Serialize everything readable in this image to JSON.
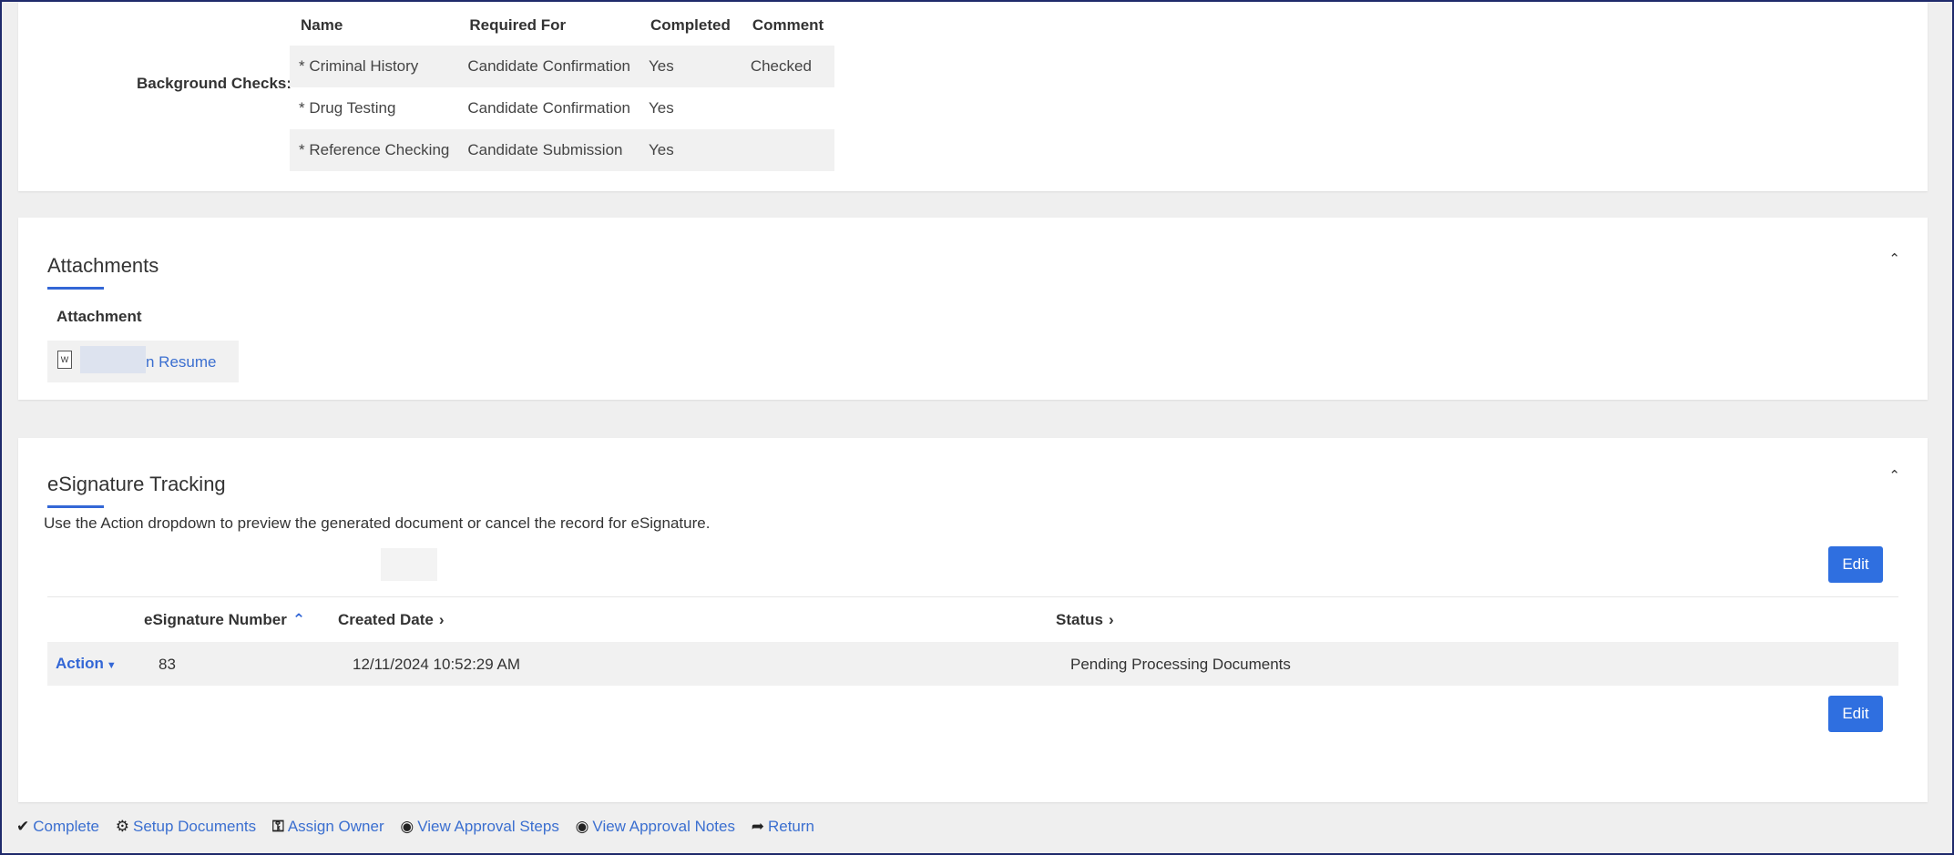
{
  "background_checks": {
    "label": "Background Checks:",
    "columns": [
      "Name",
      "Required For",
      "Completed",
      "Comment"
    ],
    "rows": [
      [
        "* Criminal History",
        "Candidate Confirmation",
        "Yes",
        "Checked"
      ],
      [
        "* Drug Testing",
        "Candidate Confirmation",
        "Yes",
        ""
      ],
      [
        "* Reference Checking",
        "Candidate Submission",
        "Yes",
        ""
      ]
    ]
  },
  "attachments": {
    "title": "Attachments",
    "column": "Attachment",
    "file_link": "n Resume",
    "collapse_icon": "double-chevron-up-icon"
  },
  "esignature": {
    "title": "eSignature Tracking",
    "description": "Use the Action dropdown to preview the generated document or cancel the record for eSignature.",
    "edit_label": "Edit",
    "columns": {
      "number": "eSignature Number",
      "created": "Created Date",
      "status": "Status"
    },
    "row": {
      "action": "Action",
      "number": "83",
      "created": "12/11/2024 10:52:29 AM",
      "status": "Pending Processing Documents"
    }
  },
  "footer": {
    "items": [
      {
        "label": "Complete",
        "icon": "check-icon"
      },
      {
        "label": "Setup Documents",
        "icon": "gear-icon"
      },
      {
        "label": "Assign Owner",
        "icon": "key-icon"
      },
      {
        "label": "View Approval Steps",
        "icon": "eye-icon"
      },
      {
        "label": "View Approval Notes",
        "icon": "eye-icon"
      },
      {
        "label": "Return",
        "icon": "return-icon"
      }
    ]
  },
  "colors": {
    "accent": "#3367d6",
    "button": "#2f6fe0"
  }
}
